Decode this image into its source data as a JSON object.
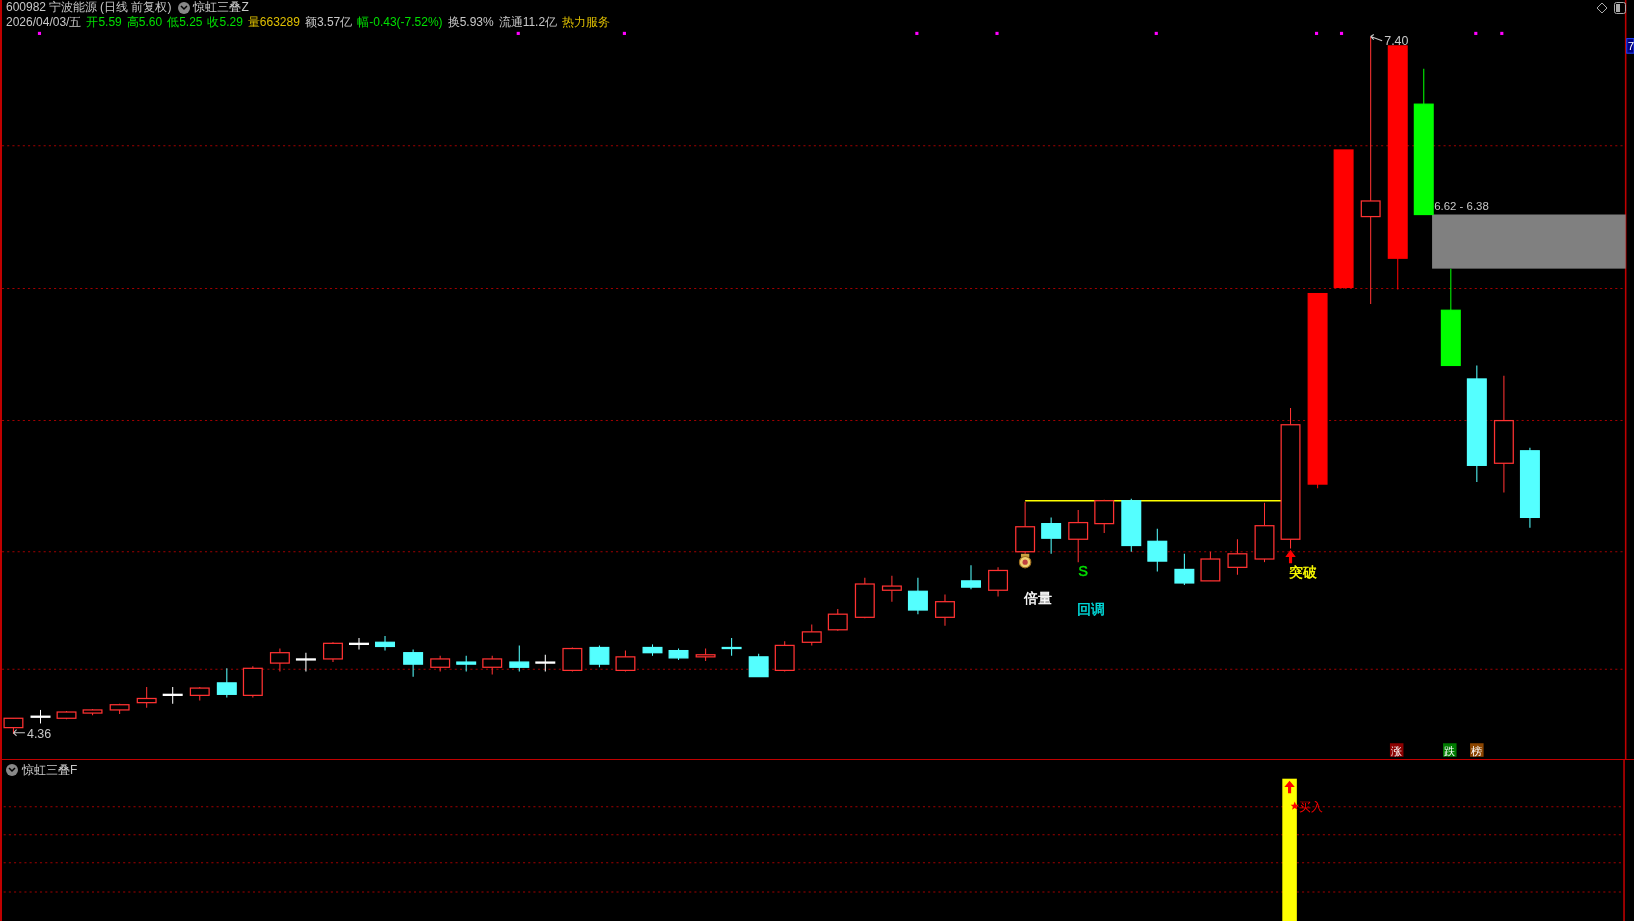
{
  "header": {
    "code": "600982",
    "name": "宁波能源",
    "period": "(日线 前复权)",
    "indicator": "惊虹三叠Z"
  },
  "quote": [
    {
      "text": "2026/04/03/五",
      "color": "#c8c8c8"
    },
    {
      "text": "开5.59",
      "color": "#00e000"
    },
    {
      "text": "高5.60",
      "color": "#00e000"
    },
    {
      "text": "低5.25",
      "color": "#00e000"
    },
    {
      "text": "收5.29",
      "color": "#00e000"
    },
    {
      "text": "量663289",
      "color": "#e0c000"
    },
    {
      "text": "额3.57亿",
      "color": "#c8c8c8"
    },
    {
      "text": "幅-0.43(-7.52%)",
      "color": "#00e000"
    },
    {
      "text": "换5.93%",
      "color": "#c8c8c8"
    },
    {
      "text": "流通11.2亿",
      "color": "#c8c8c8"
    },
    {
      "text": "热力服务",
      "color": "#e0c000"
    }
  ],
  "chart": {
    "high_label": "7.40",
    "low_label": "4.36",
    "zone_label": "6.62 - 6.38",
    "axis_label": "7",
    "signals": [
      {
        "text": "倍量",
        "color": "#ffffff"
      },
      {
        "text": "S",
        "color": "#00e000"
      },
      {
        "text": "回调",
        "color": "#00e0e0"
      },
      {
        "text": "突破",
        "color": "#ffff00"
      }
    ],
    "badges": [
      {
        "text": "涨",
        "color": "#8b0000"
      },
      {
        "text": "跌",
        "color": "#007a00"
      },
      {
        "text": "榜",
        "color": "#8b4500"
      }
    ]
  },
  "sub_panel": {
    "indicator": "惊虹三叠F",
    "signal": "买入"
  }
}
